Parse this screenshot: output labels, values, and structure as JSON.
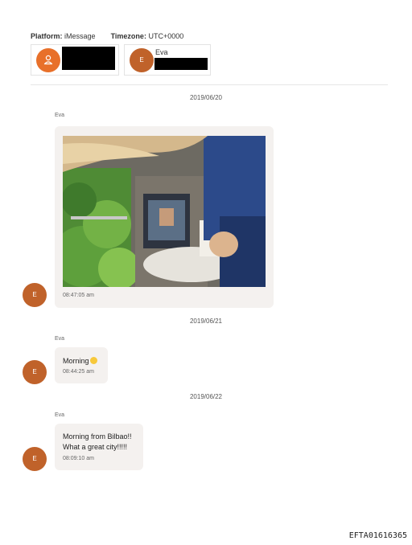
{
  "header": {
    "platform_label": "Platform:",
    "platform_value": "iMessage",
    "timezone_label": "Timezone:",
    "timezone_value": "UTC+0000"
  },
  "participants": [
    {
      "avatar_icon": "person-icon",
      "color": "#e8702a"
    },
    {
      "avatar_letter": "E",
      "name": "Eva",
      "color": "#c0622a"
    }
  ],
  "conversation": [
    {
      "date": "2019/06/20",
      "sender": "Eva",
      "avatar_letter": "E",
      "attachment": "photo",
      "time": "08:47:05 am"
    },
    {
      "date": "2019/06/21",
      "sender": "Eva",
      "avatar_letter": "E",
      "text": "Morning",
      "emoji": "smiling-face",
      "time": "08:44:25 am"
    },
    {
      "date": "2019/06/22",
      "sender": "Eva",
      "avatar_letter": "E",
      "text_line1": "Morning from Bilbao!!",
      "text_line2": "What a great city!!!!!",
      "time": "08:09:10 am"
    }
  ],
  "footer": {
    "id": "EFTA01616365"
  }
}
